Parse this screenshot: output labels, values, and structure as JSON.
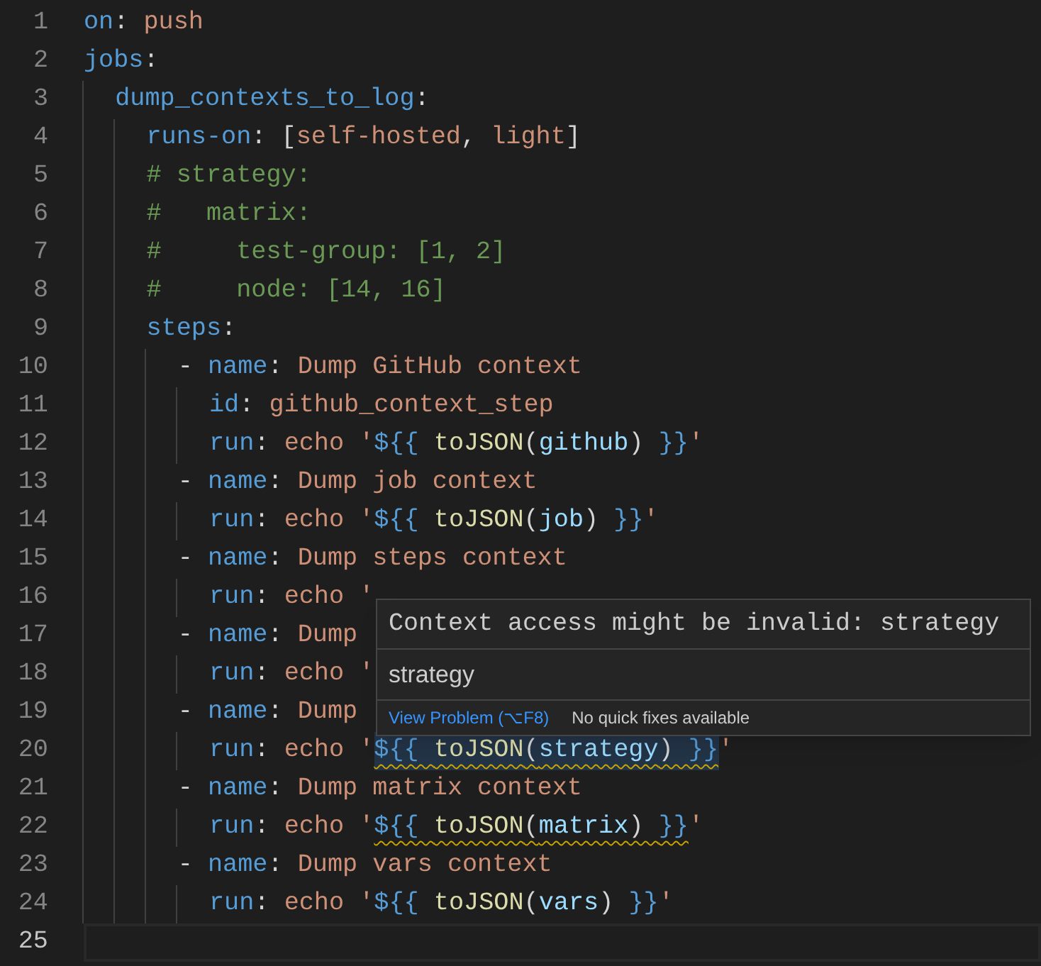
{
  "editor": {
    "lines": [
      {
        "number": "1",
        "active": false,
        "tokens": [
          {
            "text": "on",
            "kind": "key"
          },
          {
            "text": ": ",
            "kind": "punct"
          },
          {
            "text": "push",
            "kind": "string"
          }
        ]
      },
      {
        "number": "2",
        "active": false,
        "tokens": [
          {
            "text": "jobs",
            "kind": "key"
          },
          {
            "text": ":",
            "kind": "punct"
          }
        ]
      },
      {
        "number": "3",
        "active": false,
        "tokens": [
          {
            "text": "  dump_contexts_to_log",
            "kind": "key"
          },
          {
            "text": ":",
            "kind": "punct"
          }
        ]
      },
      {
        "number": "4",
        "active": false,
        "tokens": [
          {
            "text": "    runs-on",
            "kind": "key"
          },
          {
            "text": ": [",
            "kind": "punct"
          },
          {
            "text": "self-hosted",
            "kind": "string"
          },
          {
            "text": ", ",
            "kind": "punct"
          },
          {
            "text": "light",
            "kind": "string"
          },
          {
            "text": "]",
            "kind": "punct"
          }
        ]
      },
      {
        "number": "5",
        "active": false,
        "tokens": [
          {
            "text": "    # strategy:",
            "kind": "comment"
          }
        ]
      },
      {
        "number": "6",
        "active": false,
        "tokens": [
          {
            "text": "    #   matrix:",
            "kind": "comment"
          }
        ]
      },
      {
        "number": "7",
        "active": false,
        "tokens": [
          {
            "text": "    #     test-group: [1, 2]",
            "kind": "comment"
          }
        ]
      },
      {
        "number": "8",
        "active": false,
        "tokens": [
          {
            "text": "    #     node: [14, 16]",
            "kind": "comment"
          }
        ]
      },
      {
        "number": "9",
        "active": false,
        "tokens": [
          {
            "text": "    steps",
            "kind": "key"
          },
          {
            "text": ":",
            "kind": "punct"
          }
        ]
      },
      {
        "number": "10",
        "active": false,
        "tokens": [
          {
            "text": "      - ",
            "kind": "punct"
          },
          {
            "text": "name",
            "kind": "key"
          },
          {
            "text": ": ",
            "kind": "punct"
          },
          {
            "text": "Dump GitHub context",
            "kind": "string"
          }
        ]
      },
      {
        "number": "11",
        "active": false,
        "tokens": [
          {
            "text": "        id",
            "kind": "key"
          },
          {
            "text": ": ",
            "kind": "punct"
          },
          {
            "text": "github_context_step",
            "kind": "string"
          }
        ]
      },
      {
        "number": "12",
        "active": false,
        "tokens": [
          {
            "text": "        run",
            "kind": "key"
          },
          {
            "text": ": ",
            "kind": "punct"
          },
          {
            "text": "echo '",
            "kind": "string"
          },
          {
            "text": "${{ ",
            "kind": "expr"
          },
          {
            "text": "toJSON",
            "kind": "func"
          },
          {
            "text": "(",
            "kind": "punct"
          },
          {
            "text": "github",
            "kind": "var"
          },
          {
            "text": ") ",
            "kind": "punct"
          },
          {
            "text": "}}",
            "kind": "expr"
          },
          {
            "text": "'",
            "kind": "string"
          }
        ]
      },
      {
        "number": "13",
        "active": false,
        "tokens": [
          {
            "text": "      - ",
            "kind": "punct"
          },
          {
            "text": "name",
            "kind": "key"
          },
          {
            "text": ": ",
            "kind": "punct"
          },
          {
            "text": "Dump job context",
            "kind": "string"
          }
        ]
      },
      {
        "number": "14",
        "active": false,
        "tokens": [
          {
            "text": "        run",
            "kind": "key"
          },
          {
            "text": ": ",
            "kind": "punct"
          },
          {
            "text": "echo '",
            "kind": "string"
          },
          {
            "text": "${{ ",
            "kind": "expr"
          },
          {
            "text": "toJSON",
            "kind": "func"
          },
          {
            "text": "(",
            "kind": "punct"
          },
          {
            "text": "job",
            "kind": "var"
          },
          {
            "text": ") ",
            "kind": "punct"
          },
          {
            "text": "}}",
            "kind": "expr"
          },
          {
            "text": "'",
            "kind": "string"
          }
        ]
      },
      {
        "number": "15",
        "active": false,
        "tokens": [
          {
            "text": "      - ",
            "kind": "punct"
          },
          {
            "text": "name",
            "kind": "key"
          },
          {
            "text": ": ",
            "kind": "punct"
          },
          {
            "text": "Dump steps context",
            "kind": "string"
          }
        ]
      },
      {
        "number": "16",
        "active": false,
        "tokens": [
          {
            "text": "        run",
            "kind": "key"
          },
          {
            "text": ": ",
            "kind": "punct"
          },
          {
            "text": "echo '",
            "kind": "string"
          }
        ]
      },
      {
        "number": "17",
        "active": false,
        "tokens": [
          {
            "text": "      - ",
            "kind": "punct"
          },
          {
            "text": "name",
            "kind": "key"
          },
          {
            "text": ": ",
            "kind": "punct"
          },
          {
            "text": "Dump",
            "kind": "string"
          }
        ]
      },
      {
        "number": "18",
        "active": false,
        "tokens": [
          {
            "text": "        run",
            "kind": "key"
          },
          {
            "text": ": ",
            "kind": "punct"
          },
          {
            "text": "echo '",
            "kind": "string"
          }
        ]
      },
      {
        "number": "19",
        "active": false,
        "tokens": [
          {
            "text": "      - ",
            "kind": "punct"
          },
          {
            "text": "name",
            "kind": "key"
          },
          {
            "text": ": ",
            "kind": "punct"
          },
          {
            "text": "Dump",
            "kind": "string"
          }
        ]
      },
      {
        "number": "20",
        "active": false,
        "tokens": [
          {
            "text": "        run",
            "kind": "key"
          },
          {
            "text": ": ",
            "kind": "punct"
          },
          {
            "text": "echo '",
            "kind": "string"
          },
          {
            "text": "${{ toJSON(strategy) }}",
            "kind": "expr",
            "warning": true,
            "highlighted": true
          },
          {
            "text": "'",
            "kind": "string"
          }
        ]
      },
      {
        "number": "21",
        "active": false,
        "tokens": [
          {
            "text": "      - ",
            "kind": "punct"
          },
          {
            "text": "name",
            "kind": "key"
          },
          {
            "text": ": ",
            "kind": "punct"
          },
          {
            "text": "Dump matrix context",
            "kind": "string"
          }
        ]
      },
      {
        "number": "22",
        "active": false,
        "tokens": [
          {
            "text": "        run",
            "kind": "key"
          },
          {
            "text": ": ",
            "kind": "punct"
          },
          {
            "text": "echo '",
            "kind": "string"
          },
          {
            "text": "${{ toJSON(matrix) }}",
            "kind": "expr",
            "warning": true,
            "highlighted": false
          },
          {
            "text": "'",
            "kind": "string"
          }
        ]
      },
      {
        "number": "23",
        "active": false,
        "tokens": [
          {
            "text": "      - ",
            "kind": "punct"
          },
          {
            "text": "name",
            "kind": "key"
          },
          {
            "text": ": ",
            "kind": "punct"
          },
          {
            "text": "Dump vars context",
            "kind": "string"
          }
        ]
      },
      {
        "number": "24",
        "active": false,
        "tokens": [
          {
            "text": "        run",
            "kind": "key"
          },
          {
            "text": ": ",
            "kind": "punct"
          },
          {
            "text": "echo '",
            "kind": "string"
          },
          {
            "text": "${{ ",
            "kind": "expr"
          },
          {
            "text": "toJSON",
            "kind": "func"
          },
          {
            "text": "(",
            "kind": "punct"
          },
          {
            "text": "vars",
            "kind": "var"
          },
          {
            "text": ") ",
            "kind": "punct"
          },
          {
            "text": "}}",
            "kind": "expr"
          },
          {
            "text": "'",
            "kind": "string"
          }
        ]
      },
      {
        "number": "25",
        "active": true
      }
    ]
  },
  "hover": {
    "message": "Context access might be invalid: strategy",
    "detail": "strategy",
    "actions": [
      {
        "kind": "link",
        "text": "View Problem (⌥F8)"
      },
      {
        "kind": "note",
        "text": "No quick fixes available"
      }
    ]
  }
}
